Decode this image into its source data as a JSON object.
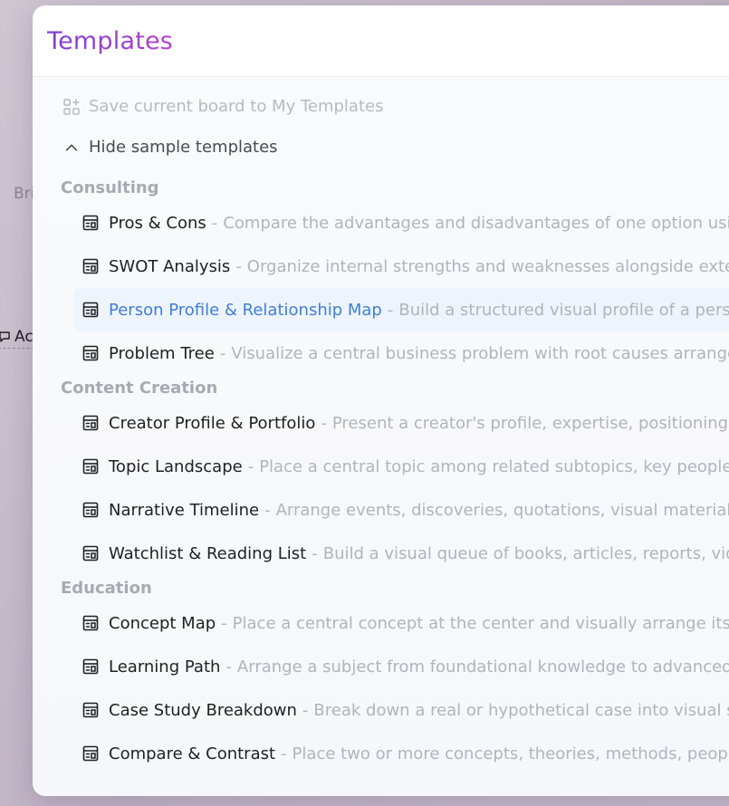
{
  "background": {
    "fragment_1": "Bri",
    "fragment_2": "Ac"
  },
  "modal": {
    "title": "Templates"
  },
  "actions": {
    "save_label": "Save current board to My Templates",
    "hide_samples_label": "Hide sample templates"
  },
  "sections": [
    {
      "title": "Consulting",
      "items": [
        {
          "name": "Pros & Cons",
          "desc": "Compare the advantages and disadvantages of one option using"
        },
        {
          "name": "SWOT Analysis",
          "desc": "Organize internal strengths and weaknesses alongside external"
        },
        {
          "name": "Person Profile & Relationship Map",
          "desc": "Build a structured visual profile of a person"
        },
        {
          "name": "Problem Tree",
          "desc": "Visualize a central business problem with root causes arranged b"
        }
      ]
    },
    {
      "title": "Content Creation",
      "items": [
        {
          "name": "Creator Profile & Portfolio",
          "desc": "Present a creator's profile, expertise, positioning, fea"
        },
        {
          "name": "Topic Landscape",
          "desc": "Place a central topic among related subtopics, key people, ev"
        },
        {
          "name": "Narrative Timeline",
          "desc": "Arrange events, discoveries, quotations, visual materials, and"
        },
        {
          "name": "Watchlist & Reading List",
          "desc": "Build a visual queue of books, articles, reports, videos"
        }
      ]
    },
    {
      "title": "Education",
      "items": [
        {
          "name": "Concept Map",
          "desc": "Place a central concept at the center and visually arrange its defi"
        },
        {
          "name": "Learning Path",
          "desc": "Arrange a subject from foundational knowledge to advanced ap"
        },
        {
          "name": "Case Study Breakdown",
          "desc": "Break down a real or hypothetical case into visual sectio"
        },
        {
          "name": "Compare & Contrast",
          "desc": "Place two or more concepts, theories, methods, people, o"
        }
      ]
    }
  ],
  "separator": "-",
  "active_item": "Person Profile & Relationship Map",
  "icons": {
    "save": "add-to-grid-icon",
    "toggle": "chevron-up-icon",
    "template": "template-layout-icon"
  },
  "colors": {
    "title_gradient_start": "#7b3fd6",
    "title_gradient_end": "#b640c9",
    "active_text": "#3f7fd7",
    "active_bg": "#eef4fb",
    "section_title": "#a9a9b1",
    "description": "#b3b3bb"
  }
}
